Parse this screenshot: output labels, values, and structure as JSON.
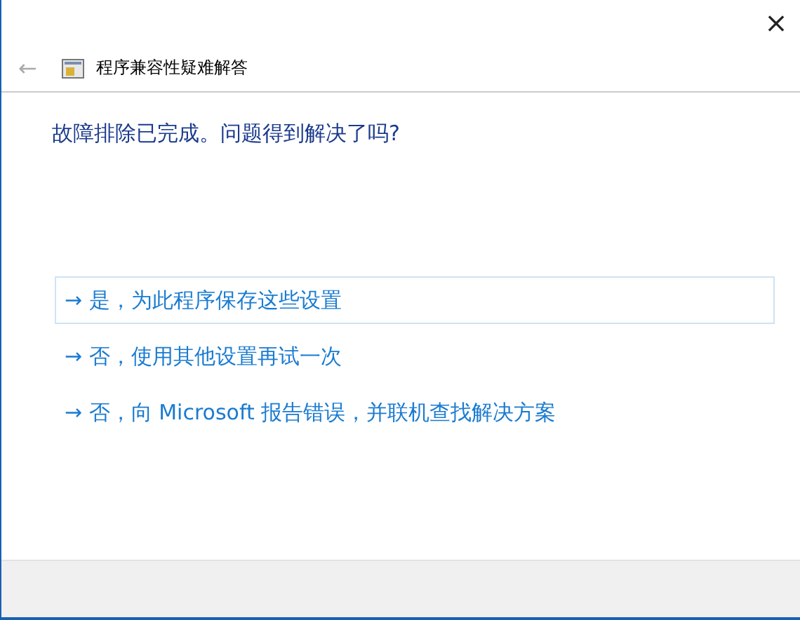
{
  "window": {
    "close_glyph": "×",
    "back_glyph": "←",
    "title": "程序兼容性疑难解答"
  },
  "heading": "故障排除已完成。问题得到解决了吗?",
  "options": [
    {
      "arrow": "→",
      "label": "是，为此程序保存这些设置",
      "selected": true
    },
    {
      "arrow": "→",
      "label": "否，使用其他设置再试一次",
      "selected": false
    },
    {
      "arrow": "→",
      "label": "否，向 Microsoft 报告错误，并联机查找解决方案",
      "selected": false
    }
  ]
}
